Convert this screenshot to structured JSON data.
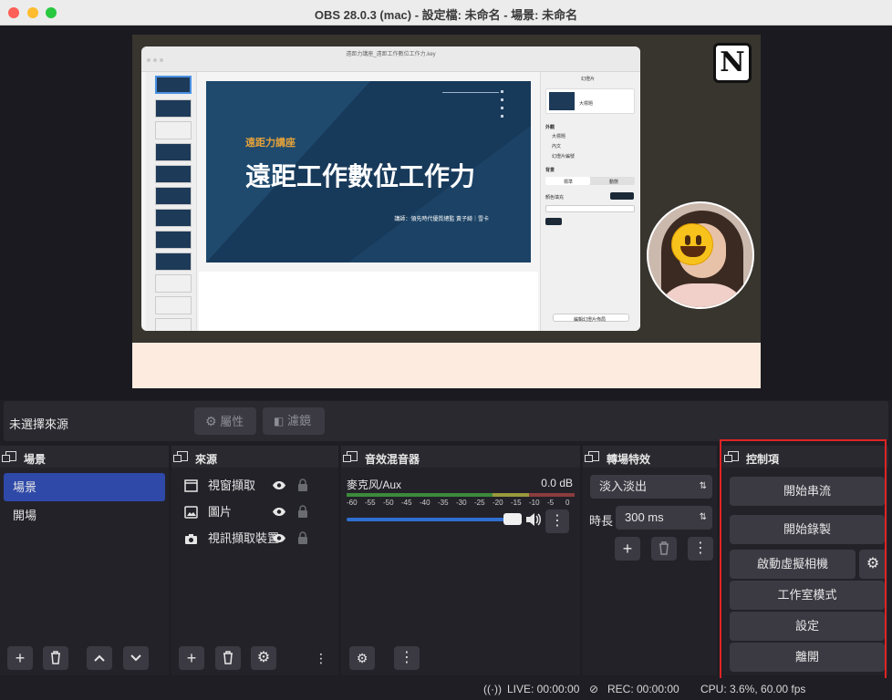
{
  "window": {
    "title": "OBS 28.0.3 (mac) - 設定檔: 未命名 - 場景: 未命名"
  },
  "preview": {
    "keynote_filename": "遠距力講座_遠距工作數位工作力.key",
    "slide_subtitle": "遠距力講座",
    "slide_title": "遠距工作數位工作力",
    "slide_credit": "講師：領先時代優質總監 黃子綺｜雪卡",
    "inspector_tab": "幻燈片",
    "inspector_layout": "大標題",
    "inspector_appearance_label": "外觀",
    "inspector_checks": [
      "大標題",
      "內文",
      "幻燈片編號"
    ],
    "inspector_bg_label": "背景",
    "inspector_seg_on": "標準",
    "inspector_seg_off": "動態",
    "inspector_fill_label": "顏色填充",
    "inspector_edit_btn": "編輯幻燈片佈局",
    "logo": "N"
  },
  "source_bar": {
    "no_source": "未選擇來源",
    "properties": "屬性",
    "filters": "濾鏡"
  },
  "docks": {
    "scenes": {
      "title": "場景",
      "items": [
        "場景",
        "開場"
      ]
    },
    "sources": {
      "title": "來源",
      "items": [
        {
          "label": "視窗擷取",
          "icon": "window-capture-icon"
        },
        {
          "label": "圖片",
          "icon": "image-icon"
        },
        {
          "label": "視訊擷取裝置",
          "icon": "camera-icon"
        }
      ]
    },
    "mixer": {
      "title": "音效混音器",
      "channel": "麥克风/Aux",
      "db": "0.0 dB",
      "scale": [
        "-60",
        "-55",
        "-50",
        "-45",
        "-40",
        "-35",
        "-30",
        "-25",
        "-20",
        "-15",
        "-10",
        "-5",
        "0"
      ],
      "volume": 1.0
    },
    "transitions": {
      "title": "轉場特效",
      "selected": "淡入淡出",
      "duration_label": "時長",
      "duration_value": "300 ms"
    },
    "controls": {
      "title": "控制項",
      "start_streaming": "開始串流",
      "start_recording": "開始錄製",
      "start_virtual_cam": "啟動虛擬相機",
      "studio_mode": "工作室模式",
      "settings": "設定",
      "exit": "離開"
    }
  },
  "status": {
    "live": "LIVE: 00:00:00",
    "rec": "REC: 00:00:00",
    "cpu": "CPU: 3.6%, 60.00 fps"
  },
  "colors": {
    "accent": "#2f49a8",
    "highlight": "#e02424",
    "panel": "#2a2930"
  }
}
